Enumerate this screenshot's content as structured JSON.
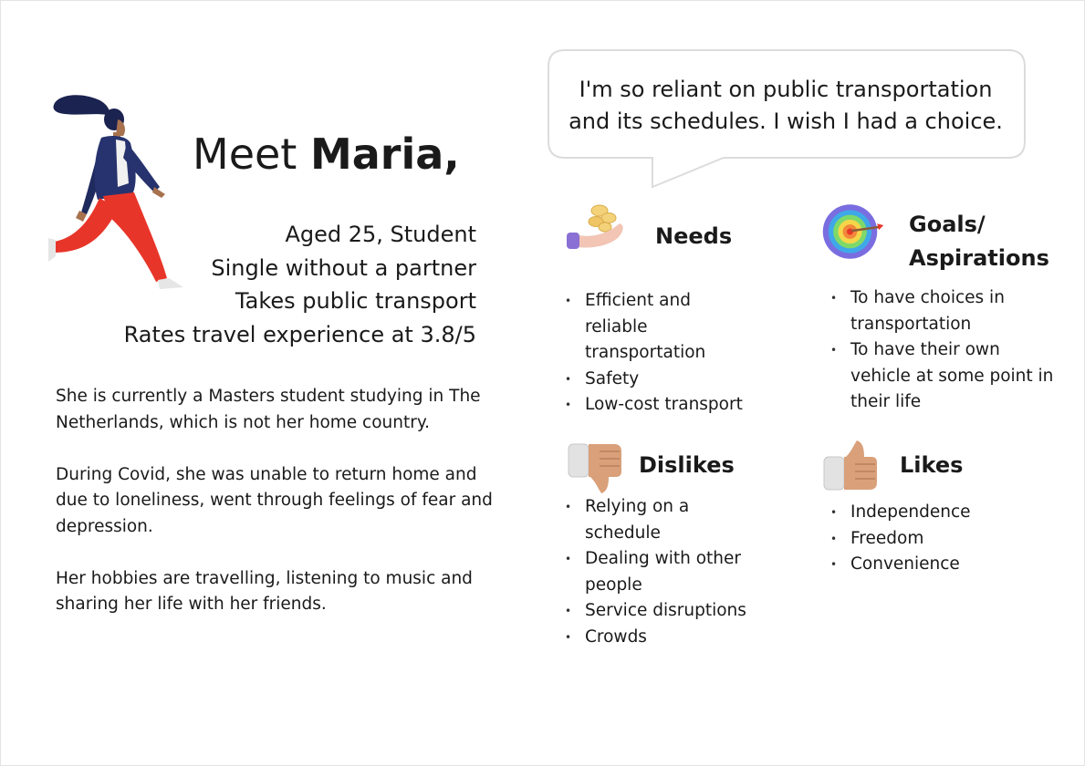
{
  "header": {
    "title_prefix": "Meet ",
    "title_name": "Maria,"
  },
  "facts": [
    "Aged 25, Student",
    "Single without a partner",
    "Takes public transport",
    "Rates travel experience at 3.8/5"
  ],
  "bio": [
    "She is currently a Masters student studying in The Netherlands, which is not her home country.",
    "During Covid, she was unable to return home and due to loneliness, went through feelings of fear and depression.",
    "Her hobbies are travelling, listening to music and sharing her life with her friends."
  ],
  "quote": {
    "line1": "I'm so reliant on public transportation",
    "line2": "and its schedules. I wish I had a choice."
  },
  "needs": {
    "title": "Needs",
    "icon": "hand-with-coins-icon",
    "items": [
      "Efficient and reliable transportation",
      "Safety",
      "Low-cost transport"
    ]
  },
  "goals": {
    "title_line1": "Goals/",
    "title_line2": "Aspirations",
    "icon": "target-icon",
    "items": [
      "To have choices in transportation",
      "To have their own vehicle at some point in their life"
    ]
  },
  "dislikes": {
    "title": "Dislikes",
    "icon": "thumbs-down-icon",
    "items": [
      "Relying on a schedule",
      "Dealing with other people",
      "Service disruptions",
      "Crowds"
    ]
  },
  "likes": {
    "title": "Likes",
    "icon": "thumbs-up-icon",
    "items": [
      "Independence",
      "Freedom",
      "Convenience"
    ]
  },
  "colors": {
    "jacket": "#27336e",
    "pants": "#e8352a",
    "skin": "#a8724f",
    "hair": "#1b2350",
    "bubble_border": "#dcdcdc"
  }
}
